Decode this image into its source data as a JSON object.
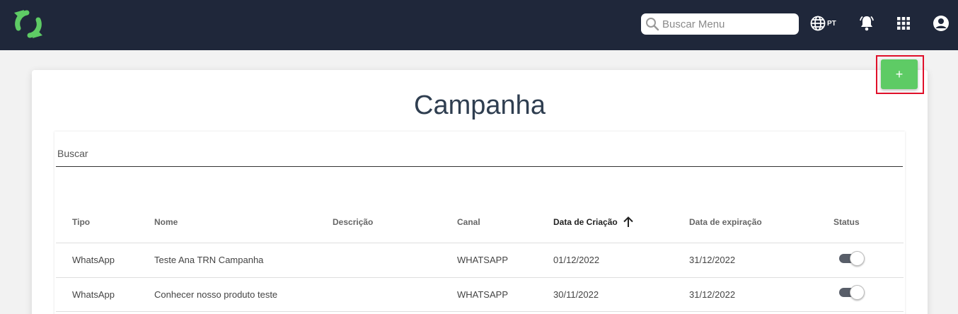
{
  "header": {
    "search_placeholder": "Buscar Menu",
    "language": "PT",
    "icons": [
      "app-logo",
      "search-icon",
      "globe-icon",
      "bell-icon",
      "apps-grid-icon",
      "account-icon"
    ],
    "brand_color": "#5ecb65",
    "bar_color": "#1f273a"
  },
  "page": {
    "title": "Campanha",
    "add_button_label": "+"
  },
  "filter": {
    "label": "Buscar"
  },
  "table": {
    "columns": [
      "Tipo",
      "Nome",
      "Descrição",
      "Canal",
      "Data de Criação",
      "Data de expiração",
      "Status"
    ],
    "sorted_column": "Data de Criação",
    "sort_direction": "ascending",
    "rows": [
      {
        "tipo": "WhatsApp",
        "nome": "Teste Ana TRN Campanha",
        "descricao": "",
        "canal": "WHATSAPP",
        "criacao": "01/12/2022",
        "expiracao": "31/12/2022",
        "status": true
      },
      {
        "tipo": "WhatsApp",
        "nome": "Conhecer nosso produto teste",
        "descricao": "",
        "canal": "WHATSAPP",
        "criacao": "30/11/2022",
        "expiracao": "31/12/2022",
        "status": true
      }
    ]
  }
}
